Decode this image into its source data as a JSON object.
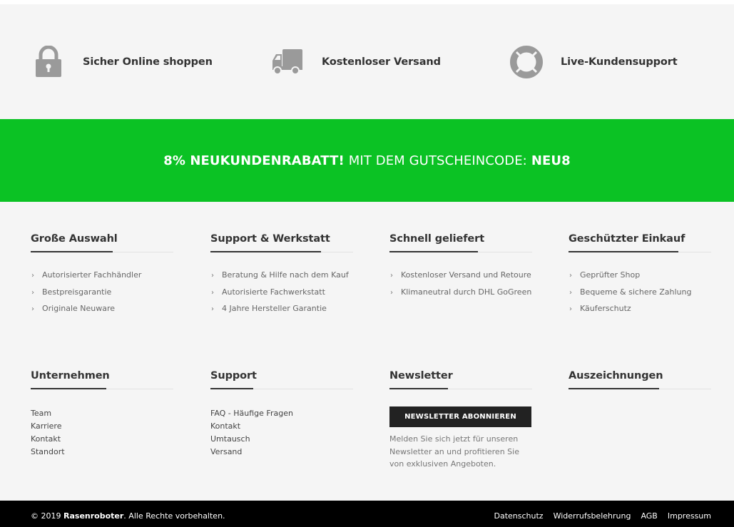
{
  "benefits": [
    {
      "icon": "lock-icon",
      "label": "Sicher Online shoppen"
    },
    {
      "icon": "truck-icon",
      "label": "Kostenloser Versand"
    },
    {
      "icon": "lifebuoy-icon",
      "label": "Live-Kundensupport"
    }
  ],
  "promo": {
    "bold_text": "8% NEUKUNDENRABATT!",
    "text": "MIT DEM GUTSCHEINCODE:",
    "code": "NEU8",
    "background": "#0bc224"
  },
  "columns_row1": [
    {
      "title": "Große Auswahl",
      "items": [
        "Autorisierter Fachhändler",
        "Bestpreisgarantie",
        "Originale Neuware"
      ]
    },
    {
      "title": "Support & Werkstatt",
      "items": [
        "Beratung & Hilfe nach dem Kauf",
        "Autorisierte Fachwerkstatt",
        "4 Jahre Hersteller Garantie"
      ]
    },
    {
      "title": "Schnell geliefert",
      "items": [
        "Kostenloser Versand und Retoure",
        "Klimaneutral durch DHL GoGreen"
      ]
    },
    {
      "title": "Geschützter Einkauf",
      "items": [
        "Geprüfter Shop",
        "Bequeme & sichere Zahlung",
        "Käuferschutz"
      ]
    }
  ],
  "columns_row2": {
    "company": {
      "title": "Unternehmen",
      "links": [
        "Team",
        "Karriere",
        "Kontakt",
        "Standort"
      ]
    },
    "support": {
      "title": "Support",
      "links": [
        "FAQ - Häufige Fragen",
        "Kontakt",
        "Umtausch",
        "Versand"
      ]
    },
    "newsletter": {
      "title": "Newsletter",
      "button_label": "NEWSLETTER ABONNIEREN",
      "description": "Melden Sie sich jetzt für unseren Newsletter an und profitieren Sie von exklusiven Angeboten."
    },
    "awards": {
      "title": "Auszeichnungen"
    }
  },
  "bottom_bar": {
    "copyright_prefix": "© 2019",
    "brand": "Rasenroboter",
    "copyright_suffix": ". Alle Rechte vorbehalten.",
    "links": [
      "Datenschutz",
      "Widerrufsbelehrung",
      "AGB",
      "Impressum"
    ]
  }
}
